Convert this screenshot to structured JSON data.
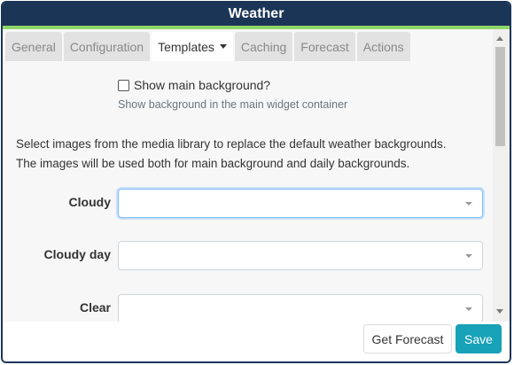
{
  "window": {
    "title": "Weather"
  },
  "tabs": [
    {
      "label": "General"
    },
    {
      "label": "Configuration"
    },
    {
      "label": "Templates",
      "active": true
    },
    {
      "label": "Caching"
    },
    {
      "label": "Forecast"
    },
    {
      "label": "Actions"
    }
  ],
  "background_option": {
    "label": "Show main background?",
    "checked": false,
    "help": "Show background in the main widget container"
  },
  "intro": {
    "line1": "Select images from the media library to replace the default weather backgrounds.",
    "line2": "The images will be used both for main background and daily backgrounds."
  },
  "fields": [
    {
      "label": "Cloudy",
      "value": ""
    },
    {
      "label": "Cloudy day",
      "value": ""
    },
    {
      "label": "Clear",
      "value": ""
    }
  ],
  "footer": {
    "get_forecast_label": "Get Forecast",
    "save_label": "Save"
  },
  "colors": {
    "title_bar": "#1b3557",
    "accent_line": "#8fd56a",
    "save_button": "#17a2b8"
  }
}
